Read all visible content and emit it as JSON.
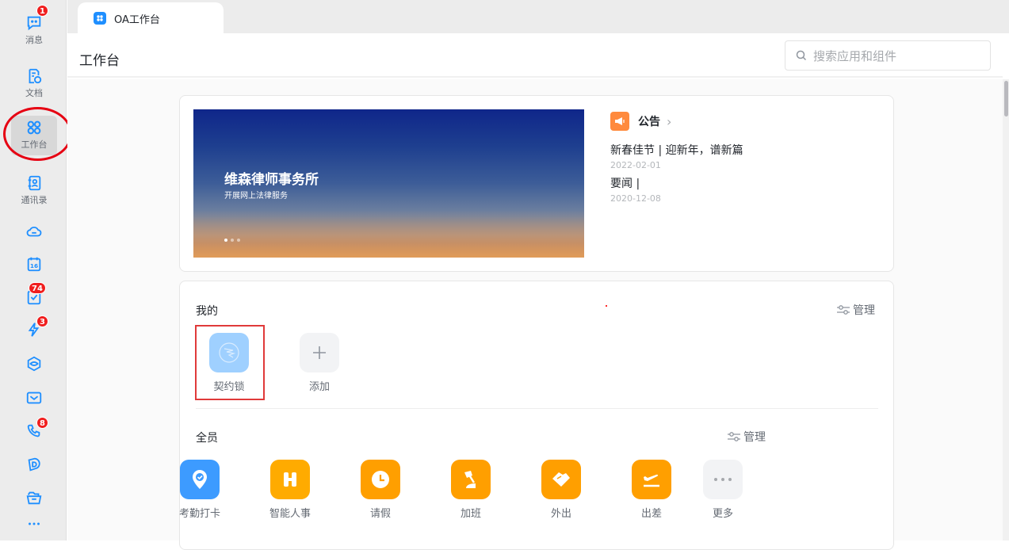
{
  "sidebar": {
    "items": [
      {
        "label": "消息",
        "icon": "message-icon",
        "badge": "1"
      },
      {
        "label": "文档",
        "icon": "document-icon"
      },
      {
        "label": "工作台",
        "icon": "workbench-icon",
        "active": true
      },
      {
        "label": "通讯录",
        "icon": "contacts-icon"
      },
      {
        "icon": "cloud-icon"
      },
      {
        "icon": "calendar-icon",
        "calendar_day": "16"
      },
      {
        "icon": "todo-icon",
        "badge": "74"
      },
      {
        "icon": "lightning-icon",
        "badge": "3"
      },
      {
        "icon": "workspace-icon"
      },
      {
        "icon": "mail-icon"
      },
      {
        "icon": "phone-icon",
        "badge": "8"
      },
      {
        "icon": "d-app-icon"
      },
      {
        "icon": "folder-icon"
      },
      {
        "icon": "more-icon"
      }
    ]
  },
  "tab": {
    "label": "OA工作台"
  },
  "header": {
    "title": "工作台",
    "search_placeholder": "搜索应用和组件"
  },
  "banner": {
    "title": "维森律师事务所",
    "subtitle": "开展网上法律服务",
    "slides": 3,
    "active_slide": 1
  },
  "notice": {
    "title": "公告",
    "items": [
      {
        "title": "新春佳节 | 迎新年，谱新篇",
        "date": "2022-02-01"
      },
      {
        "title": "要闻 |",
        "date": "2020-12-08"
      }
    ]
  },
  "mine": {
    "label": "我的",
    "manage": "管理",
    "apps": [
      {
        "label": "契约锁",
        "color": "#9fd0ff"
      },
      {
        "label": "添加",
        "color": "#f2f3f5"
      }
    ]
  },
  "all": {
    "label": "全员",
    "manage": "管理",
    "apps": [
      {
        "label": "考勤打卡",
        "color": "#3d9bff"
      },
      {
        "label": "智能人事",
        "color": "#ffab00"
      },
      {
        "label": "请假",
        "color": "#ff9f00"
      },
      {
        "label": "加班",
        "color": "#ff9f00"
      },
      {
        "label": "外出",
        "color": "#ff9f00"
      },
      {
        "label": "出差",
        "color": "#ff9f00"
      },
      {
        "label": "更多",
        "color": "#f2f3f5"
      }
    ]
  }
}
